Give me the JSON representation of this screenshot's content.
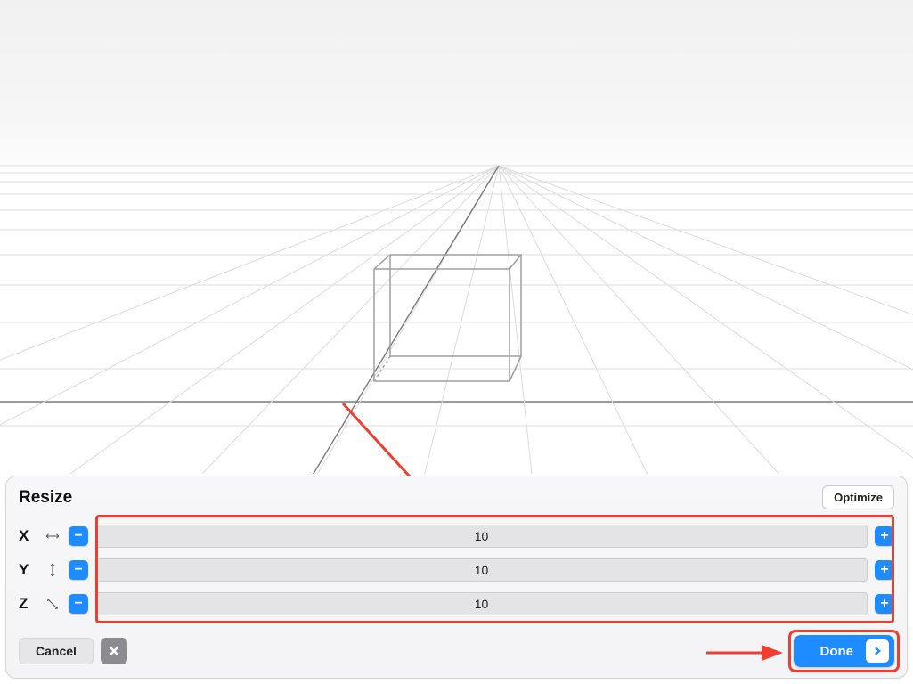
{
  "panel": {
    "title": "Resize",
    "optimize_label": "Optimize",
    "cancel_label": "Cancel",
    "done_label": "Done",
    "axes": [
      {
        "label": "X",
        "value": "10"
      },
      {
        "label": "Y",
        "value": "10"
      },
      {
        "label": "Z",
        "value": "10"
      }
    ]
  },
  "colors": {
    "accent": "#1e8bff",
    "annotation": "#f03d2f"
  }
}
